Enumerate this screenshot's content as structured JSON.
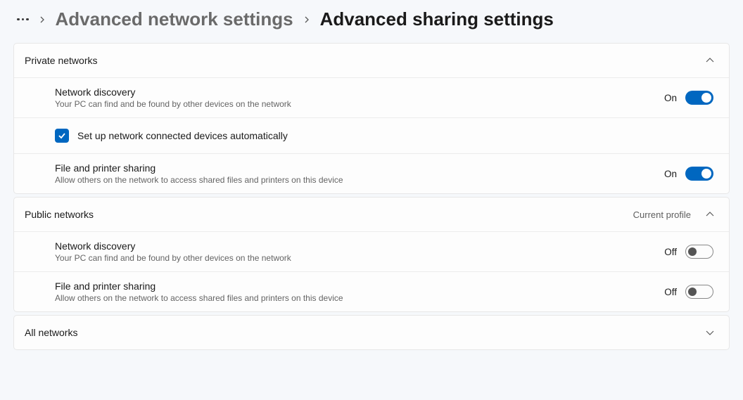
{
  "breadcrumb": {
    "parent": "Advanced network settings",
    "current": "Advanced sharing settings"
  },
  "sections": {
    "private": {
      "title": "Private networks",
      "network_discovery": {
        "title": "Network discovery",
        "desc": "Your PC can find and be found by other devices on the network",
        "state_label": "On"
      },
      "auto_setup": {
        "label": "Set up network connected devices automatically"
      },
      "file_sharing": {
        "title": "File and printer sharing",
        "desc": "Allow others on the network to access shared files and printers on this device",
        "state_label": "On"
      }
    },
    "public": {
      "title": "Public networks",
      "tag": "Current profile",
      "network_discovery": {
        "title": "Network discovery",
        "desc": "Your PC can find and be found by other devices on the network",
        "state_label": "Off"
      },
      "file_sharing": {
        "title": "File and printer sharing",
        "desc": "Allow others on the network to access shared files and printers on this device",
        "state_label": "Off"
      }
    },
    "all": {
      "title": "All networks"
    }
  }
}
